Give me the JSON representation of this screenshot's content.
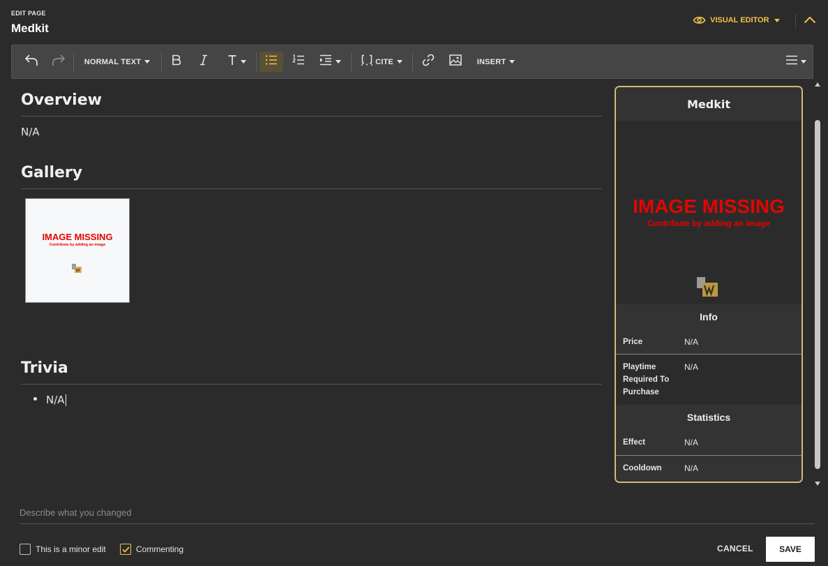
{
  "header": {
    "kicker": "EDIT PAGE",
    "title": "Medkit",
    "editor_mode": "VISUAL EDITOR",
    "accent_color": "#f2c14e"
  },
  "toolbar": {
    "undo_icon": "undo-icon",
    "redo_icon": "redo-icon",
    "paragraph_format": "NORMAL TEXT",
    "bold_icon": "bold-icon",
    "italic_icon": "italic-icon",
    "text_style_icon": "text-style-icon",
    "bullet_list_icon": "bullet-list-icon",
    "numbered_list_icon": "numbered-list-icon",
    "indent_icon": "indent-icon",
    "cite_label": "CITE",
    "link_icon": "link-icon",
    "image_icon": "image-icon",
    "insert_label": "INSERT",
    "menu_icon": "hamburger-icon"
  },
  "content": {
    "overview_heading": "Overview",
    "overview_text": "N/A",
    "gallery_heading": "Gallery",
    "gallery_image_title": "IMAGE MISSING",
    "gallery_image_subtitle": "Contribute by adding an image",
    "trivia_heading": "Trivia",
    "trivia_items": [
      "N/A"
    ]
  },
  "infobox": {
    "title": "Medkit",
    "image_title": "IMAGE MISSING",
    "image_subtitle": "Contribute by adding an image",
    "info_heading": "Info",
    "price_label": "Price",
    "price_value": "N/A",
    "playtime_label": "Playtime Required To Purchase",
    "playtime_value": "N/A",
    "statistics_heading": "Statistics",
    "effect_label": "Effect",
    "effect_value": "N/A",
    "cooldown_label": "Cooldown",
    "cooldown_value": "N/A",
    "border_color": "#d7b877"
  },
  "footer": {
    "summary_placeholder": "Describe what you changed",
    "minor_edit_label": "This is a minor edit",
    "minor_edit_checked": false,
    "commenting_label": "Commenting",
    "commenting_checked": true,
    "cancel_label": "CANCEL",
    "save_label": "SAVE"
  }
}
